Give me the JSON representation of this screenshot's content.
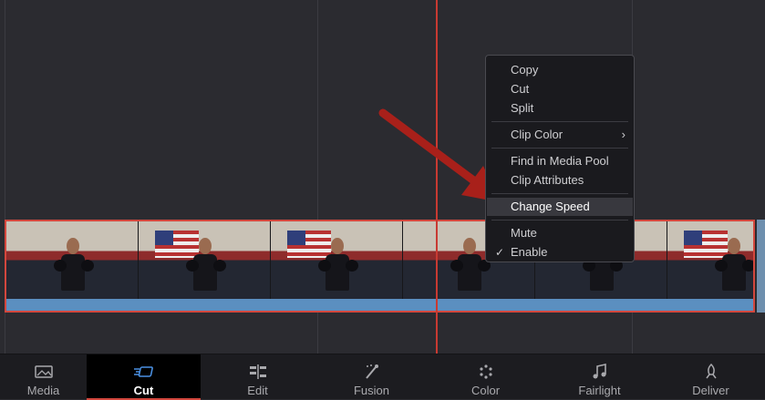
{
  "context_menu": {
    "groups": [
      [
        {
          "label": "Copy"
        },
        {
          "label": "Cut"
        },
        {
          "label": "Split"
        }
      ],
      [
        {
          "label": "Clip Color",
          "submenu": true
        }
      ],
      [
        {
          "label": "Find in Media Pool"
        },
        {
          "label": "Clip Attributes"
        }
      ],
      [
        {
          "label": "Change Speed",
          "highlighted": true
        }
      ],
      [
        {
          "label": "Mute"
        },
        {
          "label": "Enable",
          "checked": true
        }
      ]
    ],
    "submenu_glyph": "›",
    "check_glyph": "✓"
  },
  "pages": [
    {
      "label": "Media",
      "icon": "media-icon"
    },
    {
      "label": "Cut",
      "icon": "cut-icon",
      "active": true
    },
    {
      "label": "Edit",
      "icon": "edit-icon"
    },
    {
      "label": "Fusion",
      "icon": "fusion-icon"
    },
    {
      "label": "Color",
      "icon": "color-icon"
    },
    {
      "label": "Fairlight",
      "icon": "fairlight-icon"
    },
    {
      "label": "Deliver",
      "icon": "deliver-icon"
    }
  ],
  "colors": {
    "playhead": "#c83a32",
    "clip_border": "#d3473d",
    "audio_track": "#5b8fc0",
    "arrow": "#a8201a",
    "active_tab_accent": "#d3473d",
    "cut_icon": "#4a90e2"
  }
}
